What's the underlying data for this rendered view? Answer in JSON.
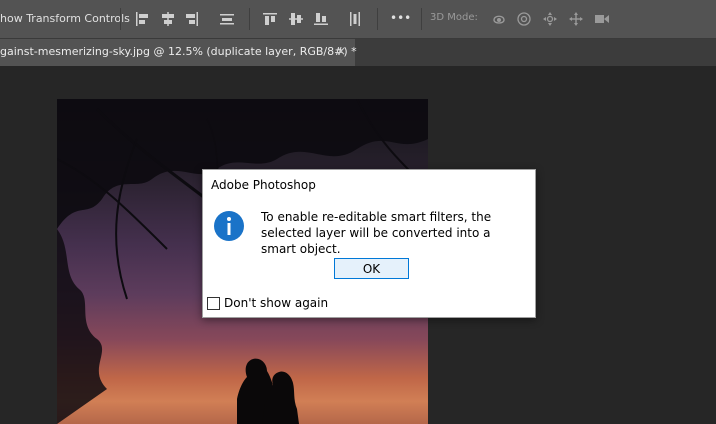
{
  "options_bar": {
    "show_transform_label": "how Transform Controls",
    "mode_3d_label": "3D Mode:",
    "more_label": "•••"
  },
  "document_tab": {
    "title": "gainst-mesmerizing-sky.jpg @ 12.5% (duplicate layer, RGB/8#) *",
    "close": "×"
  },
  "dialog": {
    "title": "Adobe Photoshop",
    "message": "To enable re-editable smart filters, the selected layer will be converted into a smart object.",
    "ok_label": "OK",
    "checkbox_label": "Don't show again",
    "checkbox_checked": false
  },
  "colors": {
    "options_bar_bg": "#535353",
    "tab_bg": "#535353",
    "canvas_bg": "#262626",
    "info_icon": "#1a73c8",
    "ok_border": "#0078d7"
  }
}
